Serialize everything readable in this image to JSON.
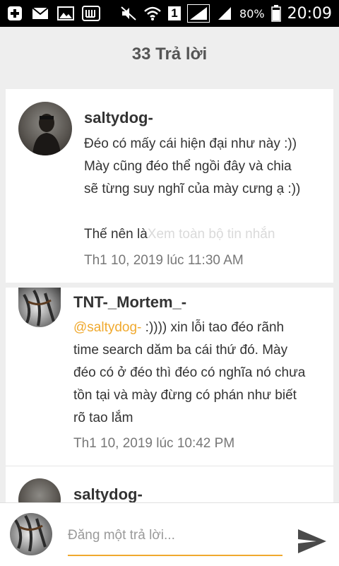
{
  "status_bar": {
    "sim_label": "1",
    "battery_percent": "80%",
    "time": "20:09"
  },
  "header": {
    "title": "33 Trả lời"
  },
  "comments": [
    {
      "author": "saltydog-",
      "lines": [
        "Đéo có mấy cái hiện đại như này :))",
        "Mày cũng đéo thể ngồi đây và chia",
        "sẽ từng suy nghĩ của mày cưng ạ :))",
        "",
        "Thế nên là"
      ],
      "more_link": "Xem toàn bộ tin nhắn",
      "timestamp": "Th1 10, 2019 lúc 11:30 AM"
    },
    {
      "author": "TNT-_Mortem_-",
      "mention": "@saltydog-",
      "lines": [
        " :)))) xin lỗi tao đéo rãnh",
        "time search dăm ba cái thứ đó. Mày",
        "đéo có ở đéo thì đéo có nghĩa nó chưa",
        "tồn tại và mày đừng có phán như biết",
        "rõ tao lắm"
      ],
      "timestamp": "Th1 10, 2019 lúc 10:42 PM"
    },
    {
      "author": "saltydog-"
    }
  ],
  "compose": {
    "placeholder": "Đăng một trả lời..."
  },
  "colors": {
    "accent": "#f0a92e",
    "status_bar": "#000000",
    "background": "#eeeeee"
  },
  "icons": [
    "notification-add-icon",
    "mail-icon",
    "image-icon",
    "app-w-icon",
    "mute-icon",
    "wifi-icon",
    "sim-icon",
    "signal-icon",
    "battery-icon",
    "send-icon"
  ]
}
